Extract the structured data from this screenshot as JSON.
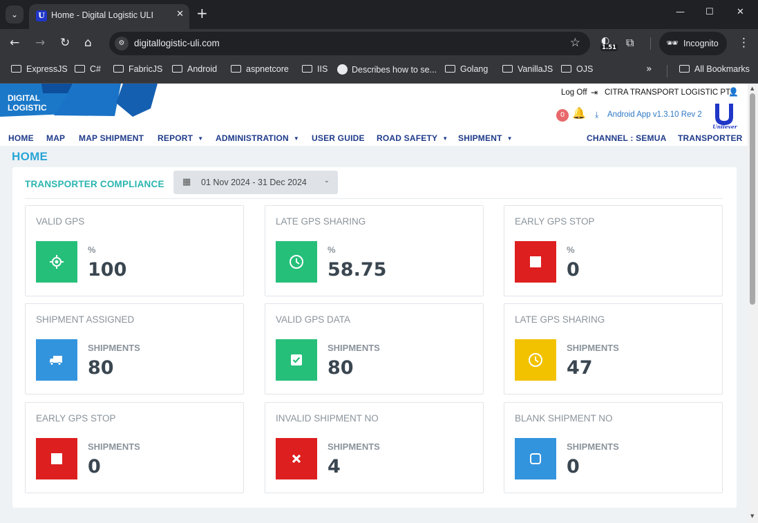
{
  "browser": {
    "tab_title": "Home - Digital Logistic ULI",
    "url": "digitallogistic-uli.com",
    "extension_badge": "1.51",
    "incognito_label": "Incognito",
    "bookmarks": [
      "ExpressJS",
      "C#",
      "FabricJS",
      "Android",
      "aspnetcore",
      "IIS",
      "Describes how to se...",
      "Golang",
      "VanillaJS",
      "OJS"
    ],
    "all_bookmarks_label": "All Bookmarks"
  },
  "header": {
    "logo_line1": "DIGITAL",
    "logo_line2": "LOGISTIC",
    "logoff_label": "Log Off",
    "company_name": "CITRA TRANSPORT LOGISTIC PT.",
    "notification_count": "0",
    "android_app_label": "Android App v1.3.10 Rev 2",
    "brand_label": "Unilever"
  },
  "menu": {
    "home": "HOME",
    "map": "MAP",
    "map_shipment": "MAP SHIPMENT",
    "report": "REPORT",
    "administration": "ADMINISTRATION",
    "user_guide": "USER GUIDE",
    "road_safety": "ROAD SAFETY",
    "shipment": "SHIPMENT",
    "channel": "CHANNEL : SEMUA",
    "transporter": "TRANSPORTER"
  },
  "page": {
    "title": "HOME"
  },
  "compliance": {
    "title": "TRANSPORTER COMPLIANCE",
    "date_range": "01 Nov 2024 - 31 Dec 2024",
    "cards": [
      {
        "title": "VALID GPS",
        "unit": "%",
        "value": "100",
        "icon": "crosshair-icon",
        "color": "#26bf7a"
      },
      {
        "title": "LATE GPS SHARING",
        "unit": "%",
        "value": "58.75",
        "icon": "clock-icon",
        "color": "#26bf7a"
      },
      {
        "title": "EARLY GPS STOP",
        "unit": "%",
        "value": "0",
        "icon": "stop-icon",
        "color": "#dd1f1f"
      },
      {
        "title": "SHIPMENT ASSIGNED",
        "unit": "SHIPMENTS",
        "value": "80",
        "icon": "truck-icon",
        "color": "#3394de"
      },
      {
        "title": "VALID GPS DATA",
        "unit": "SHIPMENTS",
        "value": "80",
        "icon": "check-square-icon",
        "color": "#26bf7a"
      },
      {
        "title": "LATE GPS SHARING",
        "unit": "SHIPMENTS",
        "value": "47",
        "icon": "clock-icon",
        "color": "#f2c200"
      },
      {
        "title": "EARLY GPS STOP",
        "unit": "SHIPMENTS",
        "value": "0",
        "icon": "stop-icon",
        "color": "#dd1f1f"
      },
      {
        "title": "INVALID SHIPMENT NO",
        "unit": "SHIPMENTS",
        "value": "4",
        "icon": "x-icon",
        "color": "#dd1f1f"
      },
      {
        "title": "BLANK SHIPMENT NO",
        "unit": "SHIPMENTS",
        "value": "0",
        "icon": "square-outline-icon",
        "color": "#3394de"
      }
    ]
  }
}
